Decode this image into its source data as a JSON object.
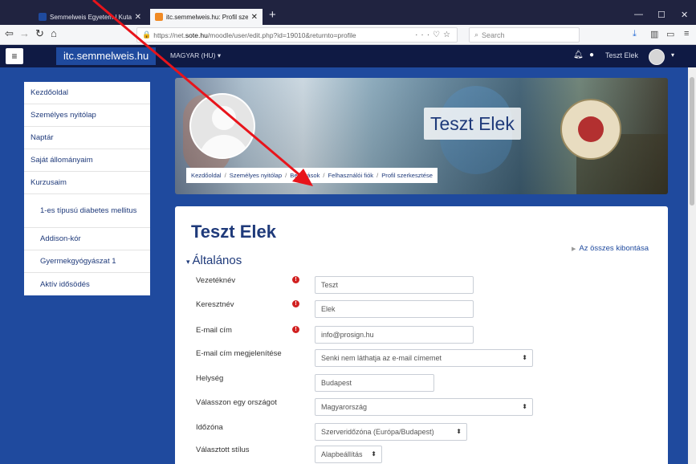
{
  "browser": {
    "tabs": [
      {
        "title": "Semmelweis Egyetem | Kutató",
        "favicon_color": "#1f4a9e"
      },
      {
        "title": "itc.semmelweis.hu: Profil szerk",
        "favicon_color": "#f08a24"
      }
    ],
    "url_prefix": "https://net.",
    "url_domain": "sote.hu",
    "url_suffix": "/moodle/user/edit.php?id=19010&returnto=profile",
    "search_placeholder": "Search"
  },
  "header": {
    "brand": "itc.semmelweis.hu",
    "language": "MAGYAR (HU)",
    "username": "Teszt Elek"
  },
  "sidebar": {
    "items": [
      {
        "label": "Kezdőoldal",
        "sub": false
      },
      {
        "label": "Személyes nyitólap",
        "sub": false
      },
      {
        "label": "Naptár",
        "sub": false
      },
      {
        "label": "Saját állományaim",
        "sub": false
      },
      {
        "label": "Kurzusaim",
        "sub": false
      },
      {
        "label": "1-es típusú diabetes mellitus",
        "sub": true
      },
      {
        "label": "Addison-kór",
        "sub": true
      },
      {
        "label": "Gyermekgyógyászat 1",
        "sub": true
      },
      {
        "label": "Aktív idősödés",
        "sub": true
      }
    ]
  },
  "hero": {
    "name": "Teszt Elek",
    "breadcrumb": [
      "Kezdőoldal",
      "Személyes nyitólap",
      "Beállítások",
      "Felhasználói fiók",
      "Profil szerkesztése"
    ]
  },
  "main": {
    "title": "Teszt Elek",
    "expand_all": "Az összes kibontása",
    "section": "Általános",
    "fields": [
      {
        "label": "Vezetéknév",
        "value": "Teszt",
        "required": true,
        "type": "text",
        "width": "wide"
      },
      {
        "label": "Keresztnév",
        "value": "Elek",
        "required": true,
        "type": "text",
        "width": "wide"
      },
      {
        "label": "E-mail cím",
        "value": "info@prosign.hu",
        "required": true,
        "type": "text",
        "width": "wide"
      },
      {
        "label": "E-mail cím megjelenítése",
        "value": "Senki nem láthatja az e-mail címemet",
        "required": false,
        "type": "select",
        "width": "xwide"
      },
      {
        "label": "Helység",
        "value": "Budapest",
        "required": false,
        "type": "text",
        "width": "mid"
      },
      {
        "label": "Válasszon egy országot",
        "value": "Magyarország",
        "required": false,
        "type": "select",
        "width": "xwide"
      },
      {
        "label": "Időzóna",
        "value": "Szerveridőzóna (Európa/Budapest)",
        "required": false,
        "type": "select",
        "width": "zone"
      },
      {
        "label": "Választott stílus",
        "value": "Alapbeállítás",
        "required": false,
        "type": "select",
        "width": "narrow"
      }
    ]
  },
  "colors": {
    "page_bg": "#1f4a9e",
    "header_bg": "#0f1a44",
    "accent": "#1f3a7a",
    "required": "#d12020",
    "annotation_arrow": "#e8141b"
  }
}
